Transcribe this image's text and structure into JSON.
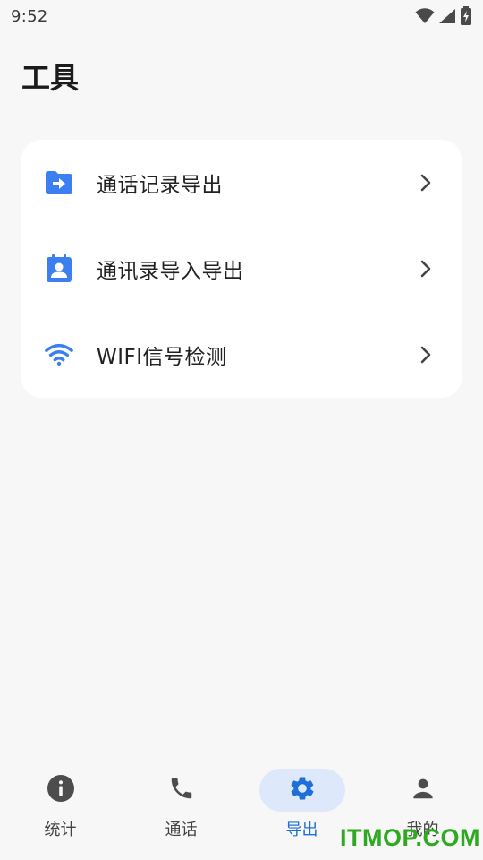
{
  "status_bar": {
    "time": "9:52",
    "icons": [
      "wifi-icon",
      "signal-icon",
      "battery-charging-icon"
    ]
  },
  "page": {
    "title": "工具"
  },
  "tools": [
    {
      "label": "通话记录导出",
      "icon": "folder-export-icon",
      "icon_color": "#3c7ff0"
    },
    {
      "label": "通讯录导入导出",
      "icon": "contact-calendar-icon",
      "icon_color": "#3c7ff0"
    },
    {
      "label": "WIFI信号检测",
      "icon": "wifi-icon",
      "icon_color": "#3c7ff0"
    }
  ],
  "bottom_nav": {
    "items": [
      {
        "label": "统计",
        "icon": "info-icon",
        "active": false
      },
      {
        "label": "通话",
        "icon": "phone-icon",
        "active": false
      },
      {
        "label": "导出",
        "icon": "gear-icon",
        "active": true
      },
      {
        "label": "我的",
        "icon": "person-icon",
        "active": false
      }
    ]
  },
  "watermark": "ITMOP.COM",
  "colors": {
    "background": "#f6f7f6",
    "card": "#ffffff",
    "accent": "#3c7ff0",
    "active_pill": "#dde9fb",
    "active_text": "#1e6fd9",
    "watermark": "#2fa91f"
  }
}
